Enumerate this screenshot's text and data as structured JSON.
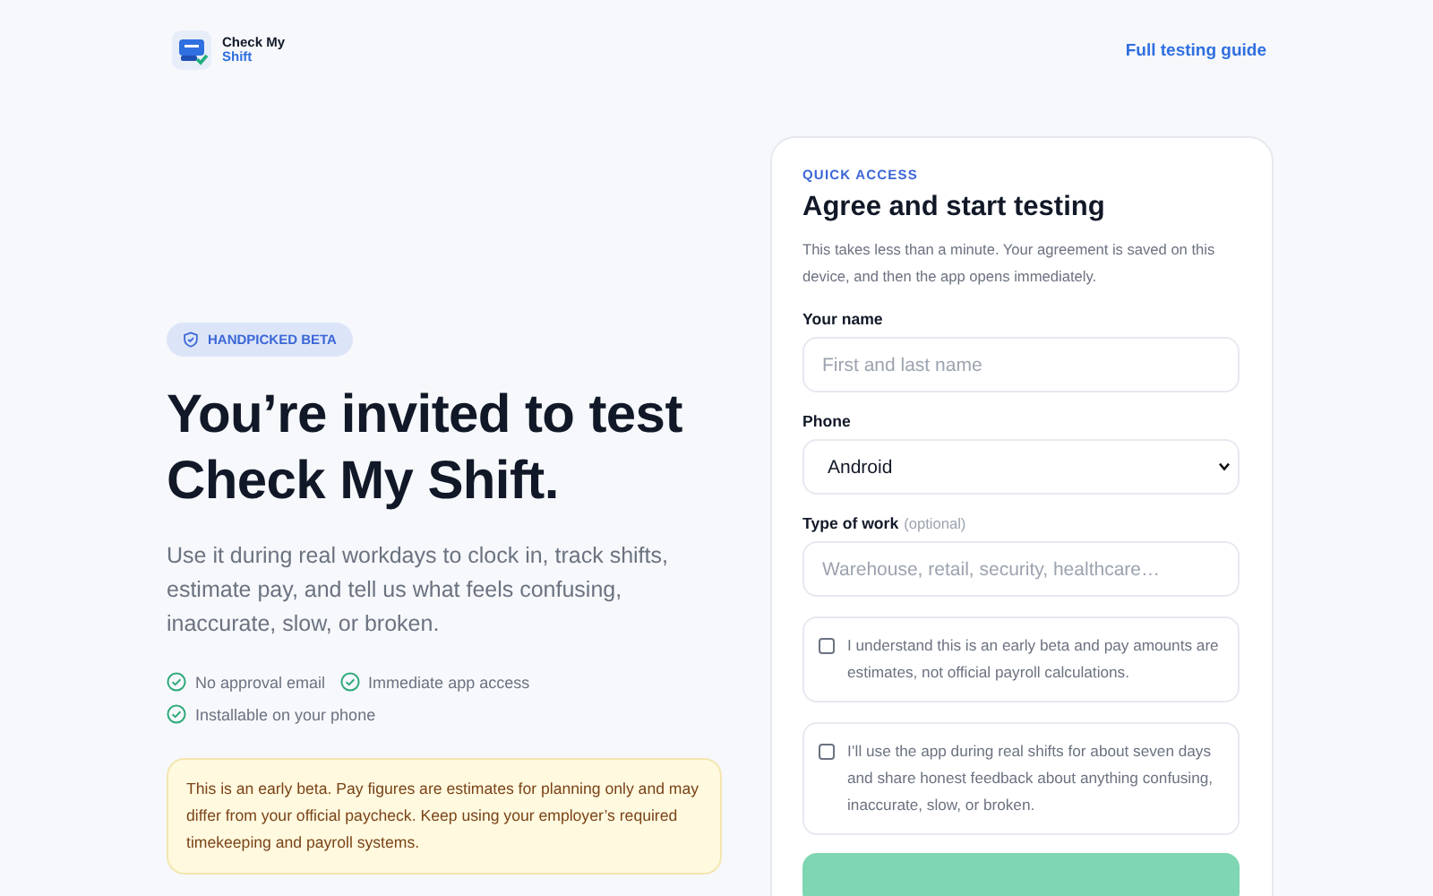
{
  "header": {
    "logo_line_1": "Check My",
    "logo_line_2": "Shift",
    "link": "Full testing guide"
  },
  "hero": {
    "badge": "HANDPICKED BETA",
    "title_line_1": "You’re invited to test",
    "title_line_2": "Check My Shift.",
    "intro": "Use it during real workdays to clock in, track shifts, estimate pay, and tell us what feels confusing, inaccurate, slow, or broken.",
    "perks": [
      "No approval email",
      "Immediate app access",
      "Installable on your phone"
    ],
    "notice": "This is an early beta. Pay figures are estimates for planning only and may differ from your official paycheck. Keep using your employer’s required timekeeping and payroll systems."
  },
  "form": {
    "eyebrow": "QUICK ACCESS",
    "title": "Agree and start testing",
    "description": "This takes less than a minute. Your agreement is saved on this device, and then the app opens immediately.",
    "fields": [
      {
        "kind": "text",
        "label": "Your name",
        "placeholder": "First and last name"
      },
      {
        "kind": "select",
        "label": "Phone",
        "value": "Android"
      },
      {
        "kind": "text",
        "label": "Type of work",
        "hint": "(optional)",
        "placeholder": "Warehouse, retail, security, healthcare…"
      }
    ],
    "agreements": [
      {
        "text": "I understand this is an early beta and pay amounts are estimates, not official payroll calculations.",
        "checked": false
      },
      {
        "text": "I’ll use the app during real shifts for about seven days and share honest feedback about anything confusing, inaccurate, slow, or broken.",
        "checked": false
      }
    ]
  }
}
